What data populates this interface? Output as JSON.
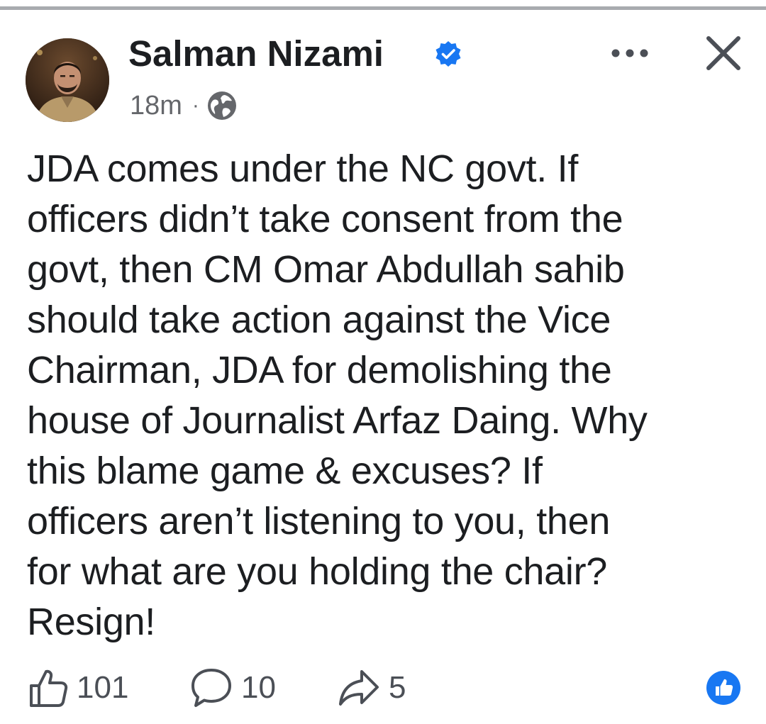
{
  "post": {
    "author": "Salman Nizami",
    "verified_icon": "verified-badge-icon",
    "time": "18m",
    "separator": "·",
    "audience_icon": "globe-icon",
    "text": "JDA comes under the NC govt. If\nofficers didn’t take consent from the\ngovt, then CM Omar Abdullah sahib\nshould take action against the Vice\nChairman, JDA for demolishing the\nhouse of Journalist Arfaz Daing. Why\nthis blame game & excuses? If\nofficers aren’t listening to you, then\nfor what are you holding the chair?\nResign!"
  },
  "header_actions": {
    "more_icon": "more-options-icon",
    "close_icon": "close-icon"
  },
  "stats": {
    "likes": "101",
    "comments": "10",
    "shares": "5"
  },
  "colors": {
    "accent": "#1877f2",
    "text": "#1c1e21",
    "secondary": "#65676b",
    "divider": "#a8abaf"
  }
}
